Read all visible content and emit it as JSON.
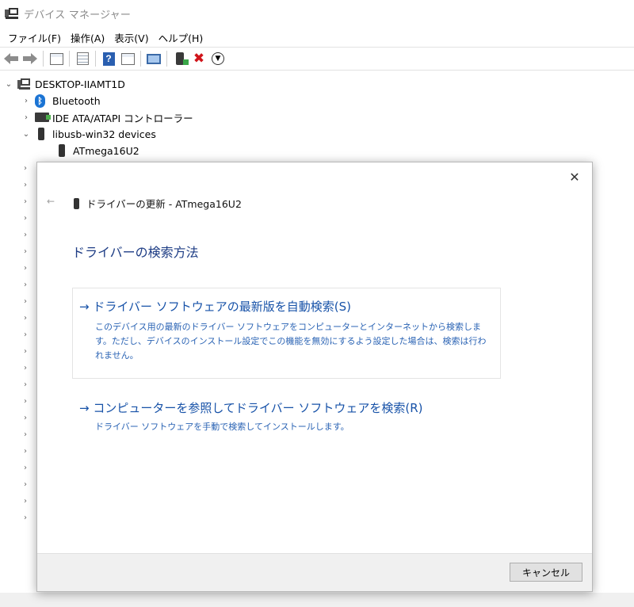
{
  "window": {
    "title": "デバイス マネージャー"
  },
  "menu": [
    "ファイル(F)",
    "操作(A)",
    "表示(V)",
    "ヘルプ(H)"
  ],
  "toolbar": {
    "icons": [
      "back-arrow-icon",
      "forward-arrow-icon",
      "device-view-icon",
      "properties-icon",
      "help-icon",
      "device-resources-icon",
      "scan-hardware-icon",
      "enable-device-icon",
      "uninstall-x-icon",
      "update-driver-icon"
    ]
  },
  "tree": {
    "root": "DESKTOP-IIAMT1D",
    "items": [
      {
        "label": "Bluetooth",
        "expanded": false
      },
      {
        "label": "IDE ATA/ATAPI コントローラー",
        "expanded": false
      },
      {
        "label": "libusb-win32 devices",
        "expanded": true,
        "children": [
          "ATmega16U2"
        ]
      }
    ]
  },
  "dialog": {
    "header": "ドライバーの更新 - ATmega16U2",
    "back": "←",
    "close": "✕",
    "heading": "ドライバーの検索方法",
    "options": [
      {
        "title": "→  ドライバー ソフトウェアの最新版を自動検索(S)",
        "description": "このデバイス用の最新のドライバー ソフトウェアをコンピューターとインターネットから検索します。ただし、デバイスのインストール設定でこの機能を無効にするよう設定した場合は、検索は行われません。"
      },
      {
        "title": "→  コンピューターを参照してドライバー ソフトウェアを検索(R)",
        "description": "ドライバー ソフトウェアを手動で検索してインストールします。"
      }
    ],
    "cancel": "キャンセル"
  },
  "colors": {
    "heading": "#1e3d85",
    "link": "#1752a8",
    "description": "#2a63b4",
    "footer": "#f0f0f0"
  }
}
